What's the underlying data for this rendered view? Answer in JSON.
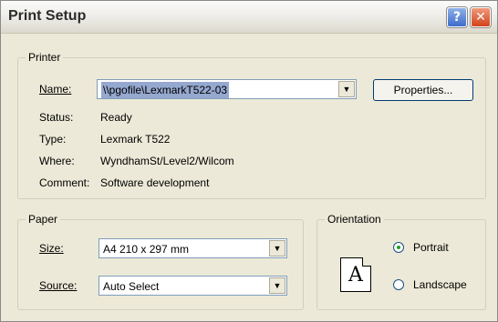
{
  "window": {
    "title": "Print Setup",
    "help_label": "?",
    "close_label": "✕"
  },
  "printer": {
    "group_label": "Printer",
    "name_label": "Name:",
    "name_value": "\\\\pgofile\\LexmarkT522-03",
    "properties_label": "Properties...",
    "status_label": "Status:",
    "status_value": "Ready",
    "type_label": "Type:",
    "type_value": "Lexmark T522",
    "where_label": "Where:",
    "where_value": "WyndhamSt/Level2/Wilcom",
    "comment_label": "Comment:",
    "comment_value": "Software development"
  },
  "paper": {
    "group_label": "Paper",
    "size_label": "Size:",
    "size_value": "A4 210 x 297 mm",
    "source_label": "Source:",
    "source_value": "Auto Select"
  },
  "orientation": {
    "group_label": "Orientation",
    "icon_letter": "A",
    "portrait_label": "Portrait",
    "landscape_label": "Landscape",
    "selected": "Portrait"
  },
  "icons": {
    "dropdown": "chevron-down-icon",
    "orientation": "page-portrait-icon"
  }
}
